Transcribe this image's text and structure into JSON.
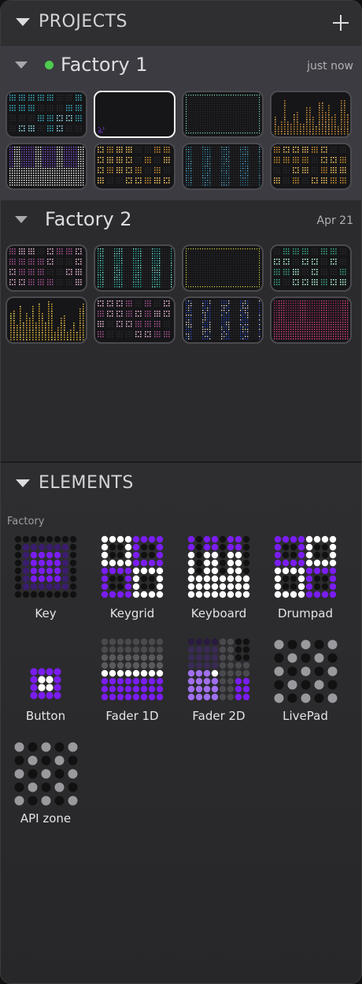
{
  "projects_section": {
    "title": "PROJECTS",
    "add_icon": "plus-icon",
    "collapse_icon": "triangle-down-icon"
  },
  "projects": [
    {
      "name": "Factory 1",
      "modified": "just now",
      "status": "active",
      "status_color": "#4fcb50",
      "thumbnails": [
        {
          "pattern": "blocks",
          "color": "#33a6b8",
          "second": "#8fd6e0"
        },
        {
          "pattern": "empty",
          "color": "#6a2fc8",
          "second": "#ffffff"
        },
        {
          "pattern": "dots",
          "color": "#2f6e57",
          "second": "#7fe0bd"
        },
        {
          "pattern": "columns",
          "color": "#b87f2e",
          "second": "#e0b060"
        },
        {
          "pattern": "keys",
          "color": "#8050d8",
          "second": "#ffffff"
        },
        {
          "pattern": "blocks",
          "color": "#c78c2e",
          "second": "#f0c060"
        },
        {
          "pattern": "bars",
          "color": "#2d6f8a",
          "second": "#60b0d0"
        },
        {
          "pattern": "blocks",
          "color": "#c78c2e",
          "second": "#f0c060"
        }
      ]
    },
    {
      "name": "Factory 2",
      "modified": "Apr 21",
      "status": "inactive",
      "status_color": "",
      "thumbnails": [
        {
          "pattern": "blocks",
          "color": "#a0508c",
          "second": "#e0b0d0"
        },
        {
          "pattern": "bars",
          "color": "#2fb0a0",
          "second": "#80f0e0"
        },
        {
          "pattern": "dots",
          "color": "#b04090",
          "second": "#d0d040"
        },
        {
          "pattern": "blocks",
          "color": "#38a080",
          "second": "#b0f0d0"
        },
        {
          "pattern": "columns",
          "color": "#c8a030",
          "second": "#f0d060"
        },
        {
          "pattern": "blocks",
          "color": "#a0508c",
          "second": "#e0b0d0"
        },
        {
          "pattern": "bars",
          "color": "#3050c0",
          "second": "#e0e0e0"
        },
        {
          "pattern": "keys",
          "color": "#a02860",
          "second": "#e04080"
        }
      ]
    }
  ],
  "elements_section": {
    "title": "ELEMENTS",
    "group": "Factory",
    "items": [
      {
        "name": "Key",
        "icon": "key-icon",
        "style": "key"
      },
      {
        "name": "Keygrid",
        "icon": "keygrid-icon",
        "style": "keygrid"
      },
      {
        "name": "Keyboard",
        "icon": "keyboard-icon",
        "style": "keyboard"
      },
      {
        "name": "Drumpad",
        "icon": "drumpad-icon",
        "style": "drumpad"
      },
      {
        "name": "Button",
        "icon": "button-icon",
        "style": "button"
      },
      {
        "name": "Fader 1D",
        "icon": "fader-1d-icon",
        "style": "fader1d"
      },
      {
        "name": "Fader 2D",
        "icon": "fader-2d-icon",
        "style": "fader2d"
      },
      {
        "name": "LivePad",
        "icon": "livepad-icon",
        "style": "livepad"
      },
      {
        "name": "API zone",
        "icon": "api-zone-icon",
        "style": "apizone"
      }
    ]
  },
  "colors": {
    "accent_purple": "#7a1df0",
    "dim_purple": "#3a1d6e",
    "gray_dot": "#9a9a9e",
    "dark_dot": "#111111"
  }
}
